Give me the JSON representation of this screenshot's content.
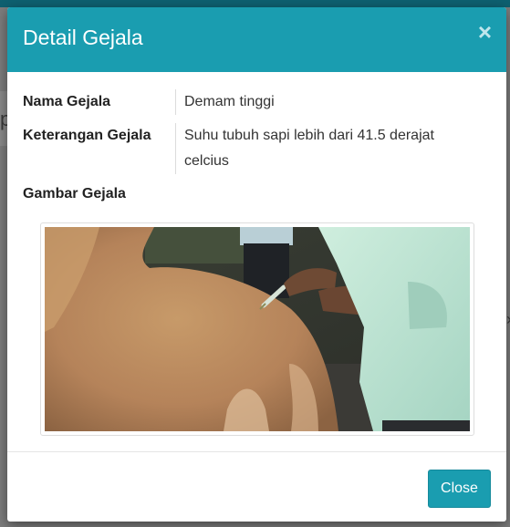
{
  "modal": {
    "title": "Detail Gejala",
    "close_icon_glyph": "×",
    "close_button_label": "Close"
  },
  "details": [
    {
      "label": "Nama Gejala",
      "value": "Demam tinggi"
    },
    {
      "label": "Keterangan Gejala",
      "value": "Suhu tubuh sapi lebih dari 41.5 derajat celcius"
    },
    {
      "label": "Gambar Gejala"
    }
  ],
  "image": {
    "subject": "cow receiving injection"
  },
  "colors": {
    "primary": "#1a9db0",
    "header_text": "#ffffff"
  }
}
